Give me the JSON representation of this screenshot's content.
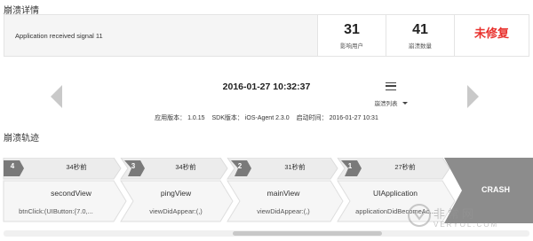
{
  "sections": {
    "detail_title": "崩溃详情",
    "trail_title": "崩溃轨迹"
  },
  "summary": {
    "message": "Application received signal 11",
    "affected_users": {
      "value": "31",
      "label": "影响用户"
    },
    "crash_count": {
      "value": "41",
      "label": "崩溃数量"
    },
    "status": "未修复",
    "status_color": "#e8302c"
  },
  "navigation": {
    "prev_icon": "chevron-left-icon",
    "next_icon": "chevron-right-icon",
    "crash_time": "2016-01-27 10:32:37",
    "list_icon": "list-icon",
    "list_label": "崩溃列表"
  },
  "meta": {
    "app_version": "应用版本： 1.0.15",
    "sdk_version": "SDK版本： iOS-Agent 2.3.0",
    "launch_time": "启动时间： 2016-01-27 10:31"
  },
  "trail": {
    "frames": [
      {
        "index": "4",
        "time": "34秒前",
        "name": "secondView",
        "call": "btnClick:(UIButton:{7.0,..."
      },
      {
        "index": "3",
        "time": "34秒前",
        "name": "pingView",
        "call": "viewDidAppear:(,)"
      },
      {
        "index": "2",
        "time": "31秒前",
        "name": "mainView",
        "call": "viewDidAppear:(,)"
      },
      {
        "index": "1",
        "time": "27秒前",
        "name": "UIApplication",
        "call": "applicationDidBecomeAc..."
      }
    ],
    "crash_label": "CRASH",
    "crash_color": "#8c8c8c"
  },
  "watermark": {
    "text_cn": "非常网",
    "text_en": "VERYOL.COM"
  }
}
